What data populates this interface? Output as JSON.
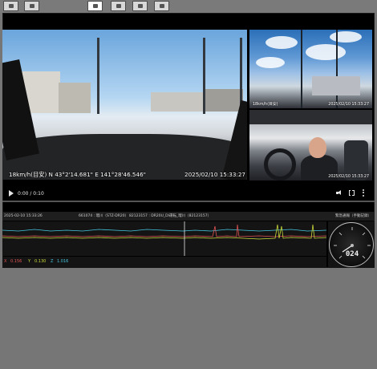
{
  "toolbar": {
    "buttons": [
      {
        "name": "Toolbar button 1",
        "icon": "save-icon"
      },
      {
        "name": "Toolbar button 2",
        "icon": "folder-icon"
      },
      {
        "name": "Toolbar button 3",
        "icon": "camera-icon"
      },
      {
        "name": "Toolbar button 4",
        "icon": "export-icon"
      },
      {
        "name": "Toolbar button 5",
        "icon": "print-icon"
      },
      {
        "name": "Toolbar button 6",
        "icon": "settings-icon"
      }
    ]
  },
  "player": {
    "overlay_left": "18km/h(目安)  N 43°2'14.681\"  E 141°28'46.546\"",
    "overlay_right": "2025/02/10 15:33:27",
    "cam_top_timestamp": "18km/h(目安)",
    "cam_top_timestamp_right": "2025/02/10 15:33:27",
    "cam_bot_timestamp": "2025/02/10 15:33:27",
    "time": "0:00 / 0:10",
    "progress": 0.0
  },
  "info_bar": {
    "datetime": "2025-02-10 15:33:26",
    "id1": "661074 : 瑠川（STZ-DR20）",
    "id2": "82123157 : DR20U_DI運転_瑠川（82123157）",
    "flag": "緊急通報（手動記録）"
  },
  "sensor": {
    "x_label": "X",
    "x_value": "0.156",
    "y_label": "Y",
    "y_value": "0.130",
    "z_label": "Z",
    "z_value": "1.016"
  },
  "speedometer": {
    "speed": "024"
  },
  "colors": {
    "x_series": "#e05454",
    "y_series": "#c9d93a",
    "z_series": "#45c7e0"
  }
}
